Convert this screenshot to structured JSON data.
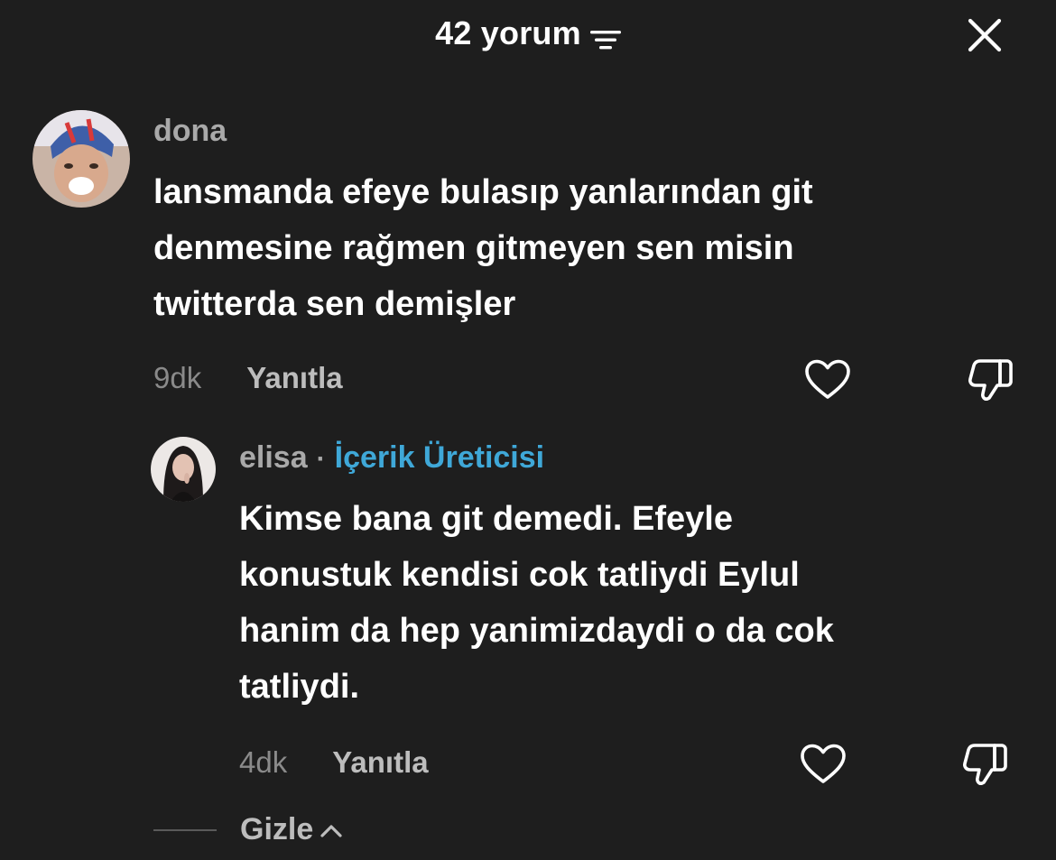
{
  "header": {
    "title": "42 yorum",
    "filter_icon": "filter-lines-icon",
    "close_icon": "close-x-icon"
  },
  "comments": [
    {
      "username": "dona",
      "avatar_icon": "avatar-photo",
      "text": "lansmanda efeye bulasıp yanlarından git\ndenmesine rağmen gitmeyen sen misin\ntwitterda sen demişler",
      "time": "9dk",
      "reply_label": "Yanıtla",
      "like_icon": "heart-icon",
      "dislike_icon": "thumbs-down-icon"
    }
  ],
  "reply": {
    "username": "elisa",
    "separator": "·",
    "badge": "İçerik Üreticisi",
    "avatar_icon": "avatar-photo",
    "text": "Kimse bana git demedi. Efeyle\nkonustuk kendisi cok tatliydi Eylul\nhanim da hep yanimizdaydi o da cok\ntatliydi.",
    "time": "4dk",
    "reply_label": "Yanıtla",
    "like_icon": "heart-icon",
    "dislike_icon": "thumbs-down-icon"
  },
  "hide": {
    "label": "Gizle",
    "icon": "chevron-up-icon"
  },
  "colors": {
    "background": "#1e1e1e",
    "text_primary": "#ffffff",
    "text_secondary": "#a9a9a9",
    "creator_badge": "#3fa8d8"
  }
}
